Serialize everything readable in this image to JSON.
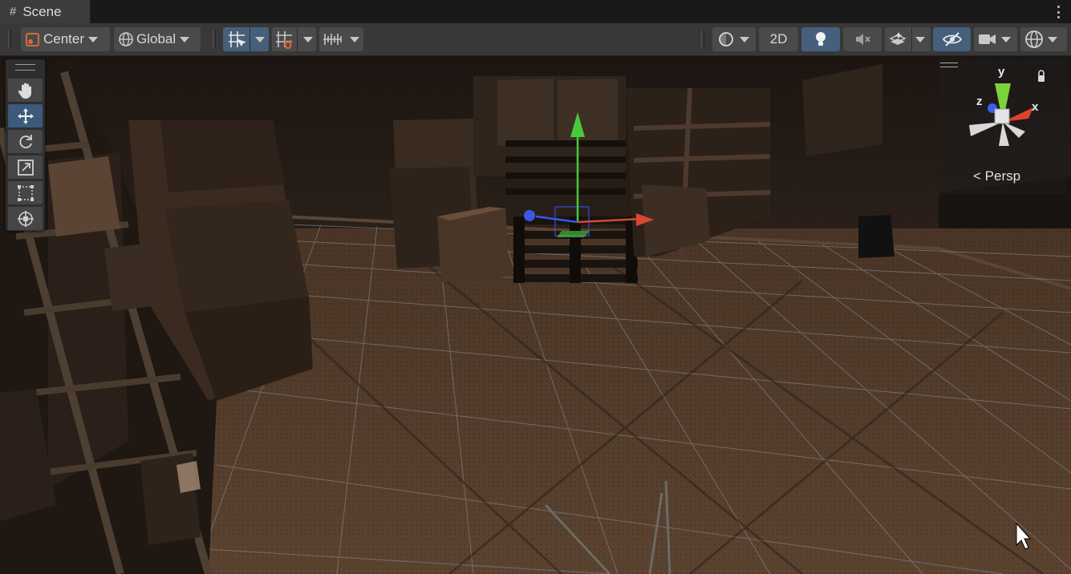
{
  "window": {
    "tab_title": "Scene",
    "tab_icon": "hash-icon"
  },
  "toolbar": {
    "pivot_mode": "Center",
    "pivot_rotation": "Global",
    "view_2d": "2D",
    "icons": [
      "grid-snap-icon",
      "increment-snap-icon",
      "ruler-icon",
      "shading-mode-icon",
      "lighting-icon",
      "audio-mute-icon",
      "effects-icon",
      "scene-visibility-icon",
      "camera-icon",
      "gizmos-icon"
    ]
  },
  "tools": [
    "hand-tool-icon",
    "move-tool-icon",
    "rotate-tool-icon",
    "scale-tool-icon",
    "rect-tool-icon",
    "transform-tool-icon"
  ],
  "active_tool": "move-tool-icon",
  "gizmo": {
    "projection": "Persp",
    "x_label": "x",
    "y_label": "y",
    "z_label": "z",
    "colors": {
      "x": "#e0402e",
      "y": "#7cd23a",
      "z": "#3a5ff0"
    }
  }
}
